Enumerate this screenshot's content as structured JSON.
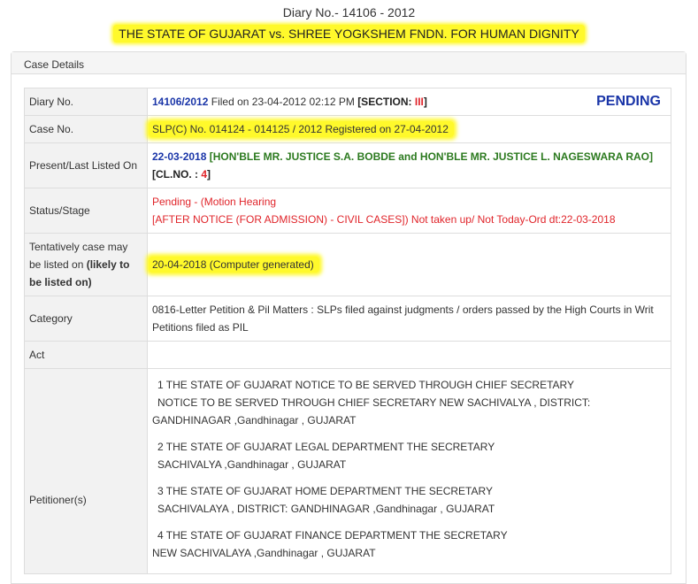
{
  "header": {
    "diary_title": "Diary No.- 14106 - 2012",
    "case_title": "THE STATE OF GUJARAT vs. SHREE YOGKSHEM FNDN. FOR HUMAN DIGNITY"
  },
  "panel": {
    "heading": "Case Details"
  },
  "rows": {
    "diary": {
      "label": "Diary No.",
      "number": "14106/2012",
      "filed": " Filed on 23-04-2012 02:12 PM ",
      "section_open": " [SECTION: ",
      "section_value": "III",
      "section_close": "]",
      "status": "PENDING"
    },
    "case_no": {
      "label": "Case No.",
      "value": "SLP(C) No. 014124 - 014125 / 2012  Registered on 27-04-2012"
    },
    "listed": {
      "label": "Present/Last Listed On",
      "date": "22-03-2018",
      "bench": " [HON'BLE MR. JUSTICE S.A. BOBDE and HON'BLE MR. JUSTICE L. NAGESWARA RAO]",
      "cl_open": "[CL.NO. : ",
      "cl_value": "4",
      "cl_close": "]"
    },
    "status": {
      "label": "Status/Stage",
      "line1": "Pending - (Motion Hearing",
      "line2": "[AFTER NOTICE (FOR ADMISSION) - CIVIL CASES]) Not taken up/ Not Today-Ord dt:22-03-2018"
    },
    "tentative": {
      "label_plain": "Tentatively case may be listed on ",
      "label_bold": "(likely to be listed on)",
      "value": "20-04-2018 (Computer generated)"
    },
    "category": {
      "label": "Category",
      "value": "0816-Letter Petition & Pil Matters : SLPs filed against judgments / orders passed by the High Courts in Writ Petitions filed as PIL"
    },
    "act": {
      "label": "Act",
      "value": ""
    },
    "petitioners": {
      "label": "Petitioner(s)",
      "items": [
        {
          "line1": "1 THE STATE OF GUJARAT NOTICE TO BE SERVED THROUGH CHIEF SECRETARY",
          "line2": " NOTICE TO BE SERVED THROUGH CHIEF SECRETARY NEW SACHIVALYA , DISTRICT:",
          "line3": "GANDHINAGAR ,Gandhinagar , GUJARAT"
        },
        {
          "line1": "2 THE STATE OF GUJARAT LEGAL DEPARTMENT THE SECRETARY",
          "line2": " SACHIVALYA ,Gandhinagar , GUJARAT"
        },
        {
          "line1": "3 THE STATE OF GUJARAT HOME DEPARTMENT THE SECRETARY",
          "line2": " SACHIVALAYA , DISTRICT: GANDHINAGAR ,Gandhinagar , GUJARAT"
        },
        {
          "line1": "4 THE STATE OF GUJARAT FINANCE DEPARTMENT THE SECRETARY",
          "line2": "NEW SACHIVALAYA ,Gandhinagar , GUJARAT"
        }
      ]
    }
  }
}
